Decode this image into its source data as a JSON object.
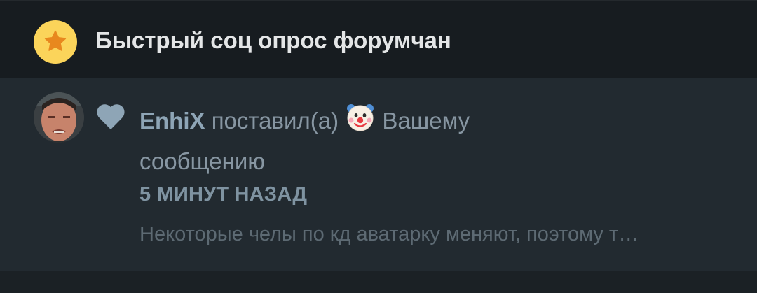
{
  "thread": {
    "title": "Быстрый соц опрос форумчан",
    "icon": "star-icon",
    "badge_color": "#fbd45a"
  },
  "alert": {
    "username": "EnhiX",
    "action": "поставил(а)",
    "reaction_icon": "clown-face-icon",
    "target": "Вашему сообщению",
    "time": "5 МИНУТ НАЗАД",
    "snippet": "Некоторые челы по кд аватарку меняют, поэтому т…"
  },
  "colors": {
    "background": "#1b2125",
    "header_bg": "#171c20",
    "item_bg": "#222a30",
    "accent": "#8ea5b6"
  }
}
